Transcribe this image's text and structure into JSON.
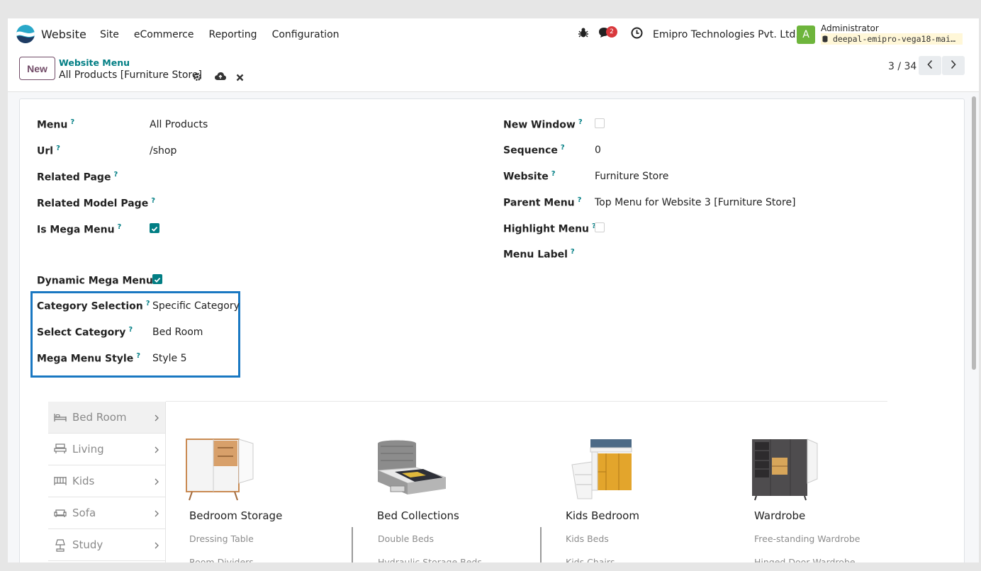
{
  "navbar": {
    "app_name": "Website",
    "menu": [
      "Site",
      "eCommerce",
      "Reporting",
      "Configuration"
    ],
    "notification_count": "2",
    "company": "Emipro Technologies Pvt. Ltd.",
    "avatar_letter": "A",
    "user_name": "Administrator",
    "db_name": "deepal-emipro-vega18-mai…"
  },
  "control_panel": {
    "new_label": "New",
    "breadcrumb_parent": "Website Menu",
    "breadcrumb_current": "All Products [Furniture Store]",
    "pager": "3 / 34"
  },
  "form": {
    "left": [
      {
        "label": "Menu",
        "help": "?",
        "value": "All Products"
      },
      {
        "label": "Url",
        "help": "?",
        "value": "/shop"
      },
      {
        "label": "Related Page",
        "help": "?",
        "value": ""
      },
      {
        "label": "Related Model Page",
        "help": "?",
        "value": ""
      },
      {
        "label": "Is Mega Menu",
        "help": "?",
        "checked": true
      },
      {
        "label": "Dynamic Mega Menu",
        "help": "?",
        "checked": true
      },
      {
        "label": "Category Selection",
        "help": "?",
        "value": "Specific Category"
      },
      {
        "label": "Select Category",
        "help": "?",
        "value": "Bed Room"
      },
      {
        "label": "Mega Menu Style",
        "help": "?",
        "value": "Style 5"
      }
    ],
    "right": [
      {
        "label": "New Window",
        "help": "?",
        "checked": false
      },
      {
        "label": "Sequence",
        "help": "?",
        "value": "0"
      },
      {
        "label": "Website",
        "help": "?",
        "value": "Furniture Store"
      },
      {
        "label": "Parent Menu",
        "help": "?",
        "value": "Top Menu for Website 3 [Furniture Store]"
      },
      {
        "label": "Highlight Menu",
        "help": "?",
        "checked": false
      },
      {
        "label": "Menu Label",
        "help": "?",
        "value": ""
      }
    ]
  },
  "mega_menu": {
    "side_items": [
      {
        "label": "Bed Room",
        "icon": "bed-icon"
      },
      {
        "label": "Living",
        "icon": "living-icon"
      },
      {
        "label": "Kids",
        "icon": "crib-icon"
      },
      {
        "label": "Sofa",
        "icon": "sofa-icon"
      },
      {
        "label": "Study",
        "icon": "lamp-icon"
      }
    ],
    "cards": [
      {
        "title": "Bedroom Storage",
        "subs": [
          "Dressing Table",
          "Room Dividers"
        ]
      },
      {
        "title": "Bed Collections",
        "subs": [
          "Double Beds",
          "Hydraulic Storage Beds"
        ]
      },
      {
        "title": "Kids Bedroom",
        "subs": [
          "Kids Beds",
          "Kids Chairs"
        ]
      },
      {
        "title": "Wardrobe",
        "subs": [
          "Free-standing Wardrobe",
          "Hinged Door Wardrobe"
        ]
      }
    ]
  },
  "colors": {
    "accent": "#017e84",
    "brand": "#714b67",
    "highlight_border": "#1a78c2",
    "badge": "#d9383c"
  }
}
